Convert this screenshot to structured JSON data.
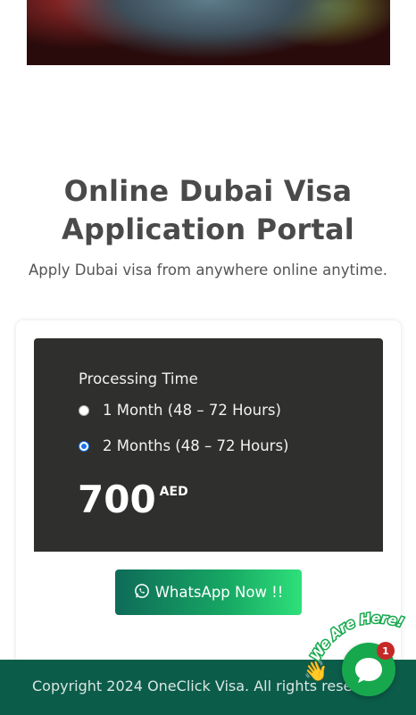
{
  "page": {
    "title": "Online Dubai Visa Application Portal",
    "subtitle": "Apply Dubai visa from anywhere online anytime."
  },
  "form": {
    "processing_label": "Processing Time",
    "options": [
      {
        "label": "1 Month (48 – 72 Hours)",
        "selected": false
      },
      {
        "label": "2 Months (48 – 72 Hours)",
        "selected": true
      }
    ],
    "price": "700",
    "currency": "AED"
  },
  "whatsapp_button": {
    "label": "WhatsApp Now !!",
    "icon": "whatsapp-icon"
  },
  "footer": {
    "text": "Copyright 2024 OneClick Visa. All rights rese..."
  },
  "chat": {
    "banner": "We Are Here!",
    "badge_count": "1",
    "icon": "chat-bubble-icon",
    "wave_icon": "waving-hand-icon"
  },
  "colors": {
    "panel": "#2f302d",
    "footer": "#0c5c4a",
    "button_start": "#0e6b58",
    "button_end": "#2ee07a",
    "chat": "#17a84d",
    "badge": "#c62828"
  }
}
